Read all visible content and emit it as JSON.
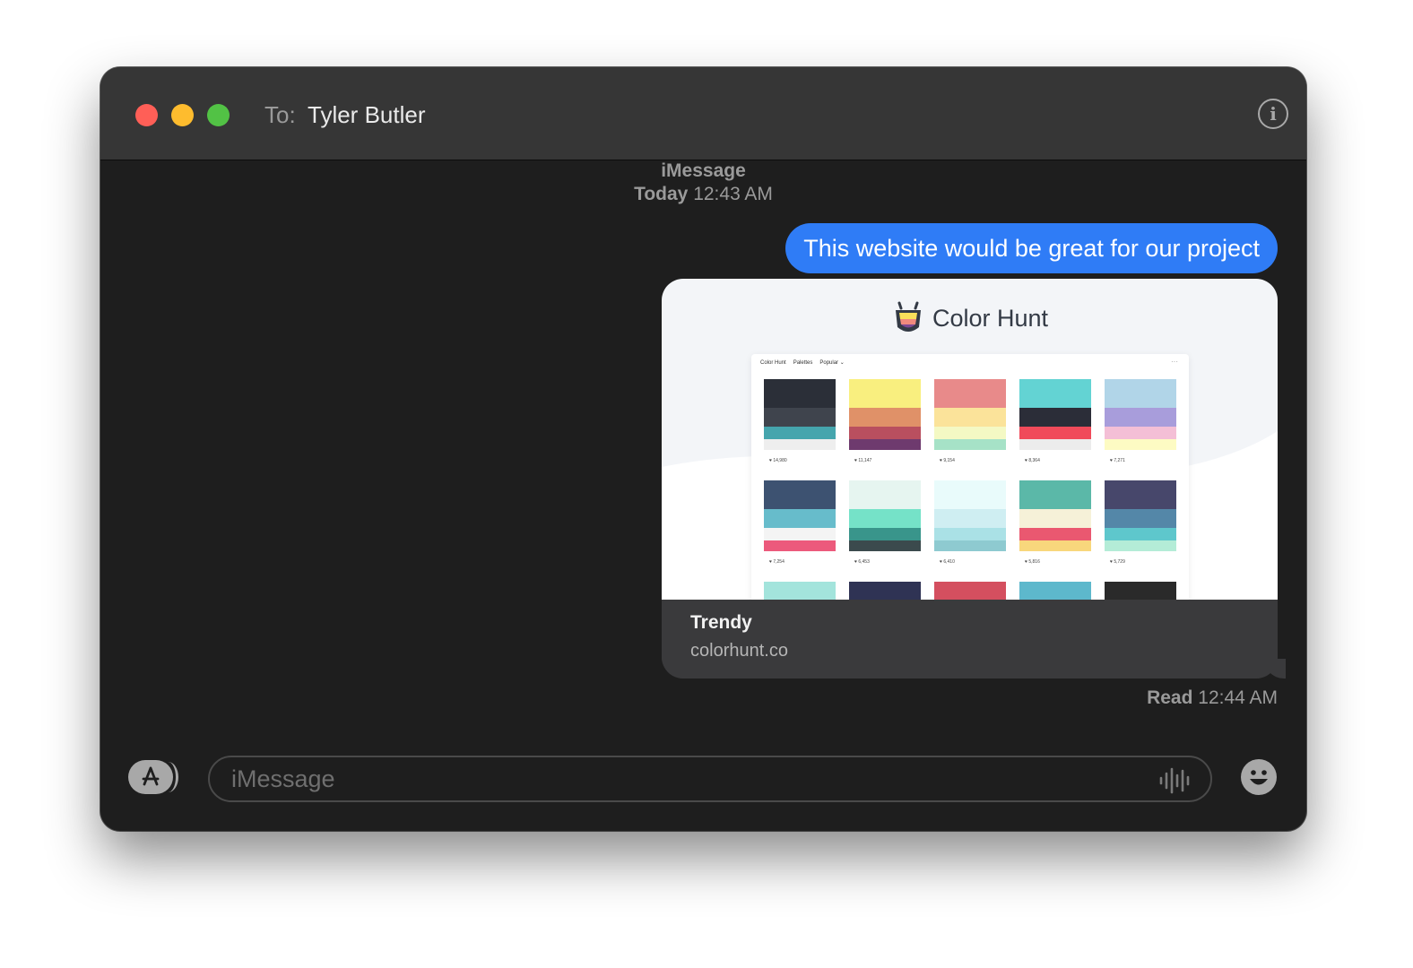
{
  "header": {
    "to_label": "To:",
    "recipient": "Tyler Butler",
    "info_icon": "info-icon"
  },
  "conversation": {
    "service": "iMessage",
    "timestamp_day": "Today",
    "timestamp_time": "12:43 AM",
    "message": "This website would be great for our project",
    "read_label": "Read",
    "read_time": "12:44 AM"
  },
  "link_preview": {
    "site_name": "Color Hunt",
    "title": "Trendy",
    "url": "colorhunt.co",
    "mini_nav": [
      "Color Hunt",
      "Palettes",
      "Popular ⌄"
    ],
    "palettes": [
      {
        "colors": [
          "#2b2f38",
          "#3f444d",
          "#45a5ad",
          "#eeeeee"
        ],
        "likes": "14,980"
      },
      {
        "colors": [
          "#f9ef7f",
          "#e09168",
          "#b94f5f",
          "#6e3a6e"
        ],
        "likes": "11,147"
      },
      {
        "colors": [
          "#e88a8a",
          "#fbe39a",
          "#f4f9c4",
          "#a6e2c7"
        ],
        "likes": "9,154"
      },
      {
        "colors": [
          "#63d3d3",
          "#2b2d38",
          "#f04a5a",
          "#ececec"
        ],
        "likes": "8,364"
      },
      {
        "colors": [
          "#b1d5e8",
          "#a89ddb",
          "#f4bfd6",
          "#fdfbc3"
        ],
        "likes": "7,271"
      },
      {
        "colors": [
          "#3d5271",
          "#67bccb",
          "#f4f4f4",
          "#ec5a7c"
        ],
        "likes": "7,254"
      },
      {
        "colors": [
          "#e6f5f0",
          "#75e2c8",
          "#39958b",
          "#3b4a4d"
        ],
        "likes": "6,453"
      },
      {
        "colors": [
          "#e9fbfb",
          "#cfeef2",
          "#aae1e6",
          "#8ecad0"
        ],
        "likes": "6,410"
      },
      {
        "colors": [
          "#5bb8a8",
          "#f6f1d8",
          "#ea5870",
          "#f8d77c"
        ],
        "likes": "5,816"
      },
      {
        "colors": [
          "#47476b",
          "#5487a8",
          "#5ec7cc",
          "#b4ecd7"
        ],
        "likes": "5,729"
      },
      {
        "colors": [
          "#a3e4dc",
          "#ffffff",
          "#ffffff",
          "#ffffff"
        ],
        "likes": ""
      },
      {
        "colors": [
          "#2f3354",
          "#ffffff",
          "#ffffff",
          "#ffffff"
        ],
        "likes": ""
      },
      {
        "colors": [
          "#d44f5f",
          "#ffffff",
          "#ffffff",
          "#ffffff"
        ],
        "likes": ""
      },
      {
        "colors": [
          "#5db8cc",
          "#ffffff",
          "#ffffff",
          "#ffffff"
        ],
        "likes": ""
      },
      {
        "colors": [
          "#2a2a2a",
          "#ffffff",
          "#ffffff",
          "#ffffff"
        ],
        "likes": ""
      }
    ]
  },
  "composer": {
    "placeholder": "iMessage",
    "apps_icon": "app-store-icon",
    "audio_icon": "audio-waveform-icon",
    "emoji_icon": "emoji-icon"
  },
  "colors": {
    "bubble": "#2f7cf6",
    "window_bg": "#1e1e1e",
    "titlebar": "#363636",
    "close": "#ff5f57",
    "minimize": "#febc2e",
    "zoom": "#52c245"
  }
}
